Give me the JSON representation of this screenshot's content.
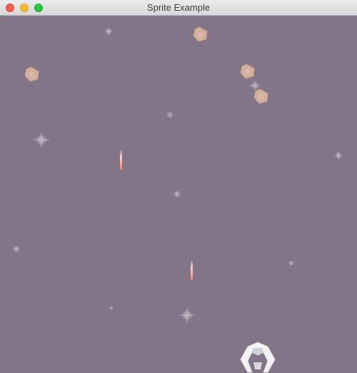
{
  "window": {
    "title": "Sprite Example"
  },
  "scene": {
    "background": "#827587",
    "asteroid_color": "#d2b09d",
    "laser_color": "#ff8a7a",
    "ship_color": "#f3f3f3"
  }
}
